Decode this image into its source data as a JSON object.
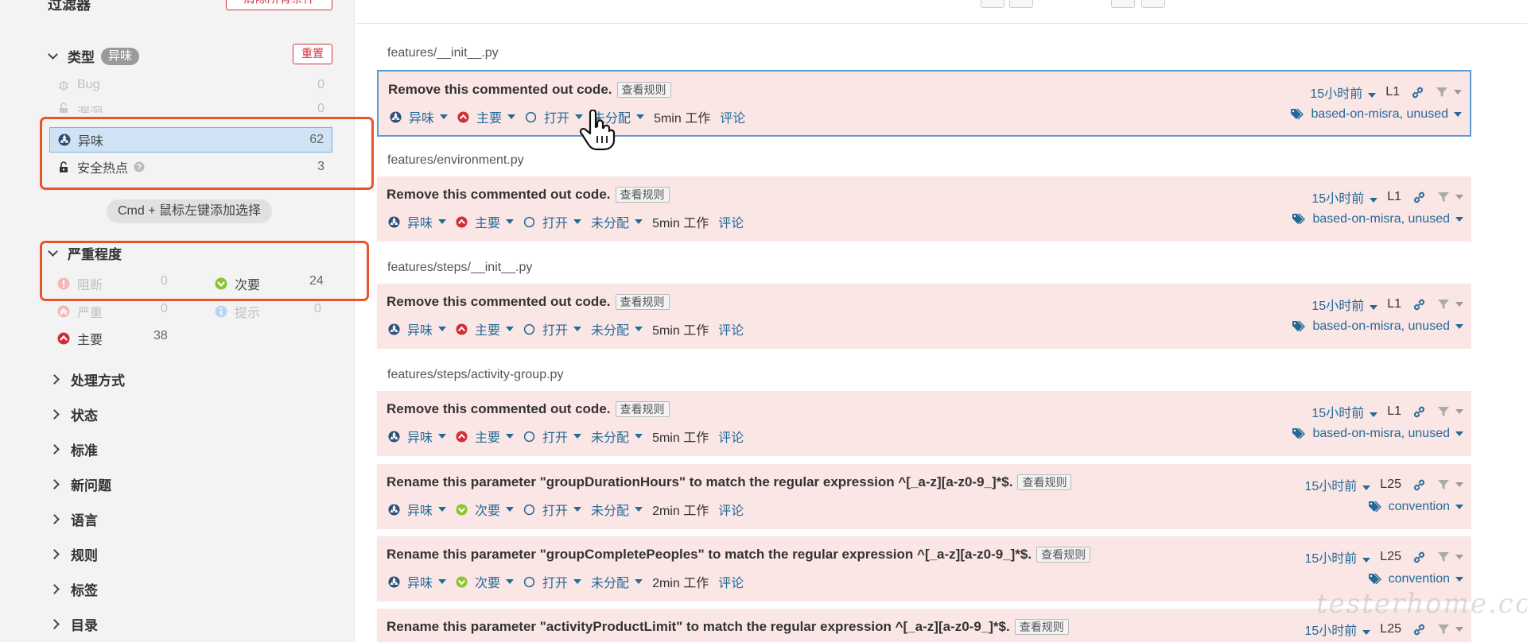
{
  "sidebar": {
    "title": "过滤器",
    "clear_all": "清除所有条件",
    "type_facet": {
      "header": "类型",
      "selected_badge": "异味",
      "reset": "重置",
      "items": [
        {
          "label": "Bug",
          "count": "0",
          "icon": "bug-icon"
        },
        {
          "label": "漏洞",
          "count": "0",
          "icon": "unlock-icon"
        },
        {
          "label": "异味",
          "count": "62",
          "icon": "code-smell-icon"
        },
        {
          "label": "安全热点",
          "count": "3",
          "icon": "security-hotspot-icon"
        }
      ]
    },
    "multi_select_hint": "Cmd + 鼠标左键添加选择",
    "severity_facet": {
      "header": "严重程度",
      "items": [
        {
          "label": "阻断",
          "count": "0",
          "icon": "blocker-icon"
        },
        {
          "label": "次要",
          "count": "24",
          "icon": "minor-icon"
        },
        {
          "label": "严重",
          "count": "0",
          "icon": "critical-icon"
        },
        {
          "label": "提示",
          "count": "0",
          "icon": "info-icon"
        },
        {
          "label": "主要",
          "count": "38",
          "icon": "major-icon"
        }
      ]
    },
    "collapsed_facets": [
      "处理方式",
      "状态",
      "标准",
      "新问题",
      "语言",
      "规则",
      "标签",
      "目录"
    ]
  },
  "common": {
    "rule_btn": "查看规则",
    "type": "异味",
    "status": "打开",
    "assignee": "未分配",
    "comment": "评论",
    "age": "15小时前"
  },
  "issues": [
    {
      "file": "features/__init__.py",
      "message": "Remove this commented out code.",
      "severity": "主要",
      "effort": "5min 工作",
      "line": "L1",
      "tags": "based-on-misra, unused"
    },
    {
      "file": "features/environment.py",
      "message": "Remove this commented out code.",
      "severity": "主要",
      "effort": "5min 工作",
      "line": "L1",
      "tags": "based-on-misra, unused"
    },
    {
      "file": "features/steps/__init__.py",
      "message": "Remove this commented out code.",
      "severity": "主要",
      "effort": "5min 工作",
      "line": "L1",
      "tags": "based-on-misra, unused"
    },
    {
      "file": "features/steps/activity-group.py",
      "message": "Remove this commented out code.",
      "severity": "主要",
      "effort": "5min 工作",
      "line": "L1",
      "tags": "based-on-misra, unused"
    },
    {
      "file": "",
      "message": "Rename this parameter \"groupDurationHours\" to match the regular expression ^[_a-z][a-z0-9_]*$.",
      "severity": "次要",
      "effort": "2min 工作",
      "line": "L25",
      "tags": "convention"
    },
    {
      "file": "",
      "message": "Rename this parameter \"groupCompletePeoples\" to match the regular expression ^[_a-z][a-z0-9_]*$.",
      "severity": "次要",
      "effort": "2min 工作",
      "line": "L25",
      "tags": "convention"
    },
    {
      "file": "",
      "message": "Rename this parameter \"activityProductLimit\" to match the regular expression ^[_a-z][a-z0-9_]*$.",
      "severity": "",
      "effort": "",
      "line": "L25",
      "tags": ""
    }
  ],
  "watermark": "testerhome.com",
  "colors": {
    "accent": "#236a97",
    "issue_bg": "#fbe6e6",
    "danger": "#d4333f",
    "highlight_box": "#e8542c"
  }
}
